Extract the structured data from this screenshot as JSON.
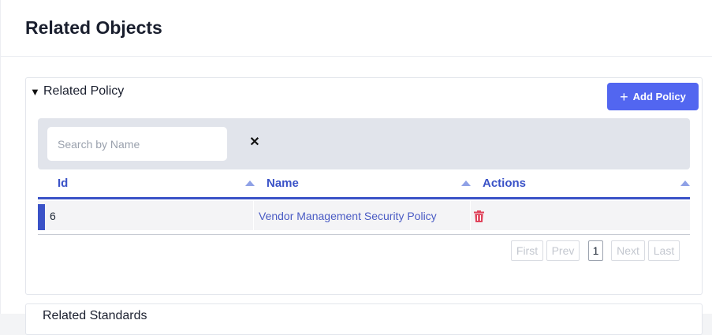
{
  "page": {
    "title": "Related Objects"
  },
  "related_policy": {
    "title": "Related Policy",
    "caret": "▼",
    "add_button_label": "Add Policy",
    "add_button_icon": "+",
    "search": {
      "placeholder": "Search by Name",
      "value": ""
    },
    "clear_icon": "✕",
    "columns": [
      "Id",
      "Name",
      "Actions"
    ],
    "rows": [
      {
        "id": "6",
        "name": "Vendor Management Security Policy",
        "action_icon": "trash-icon"
      }
    ],
    "pagination": {
      "first": "First",
      "prev": "Prev",
      "current": "1",
      "next": "Next",
      "last": "Last"
    }
  },
  "related_standards": {
    "title": "Related Standards"
  },
  "colors": {
    "accent": "#3a52c7",
    "button": "#5266f0",
    "danger": "#e0445c",
    "filter_bg": "#e1e4eb"
  }
}
